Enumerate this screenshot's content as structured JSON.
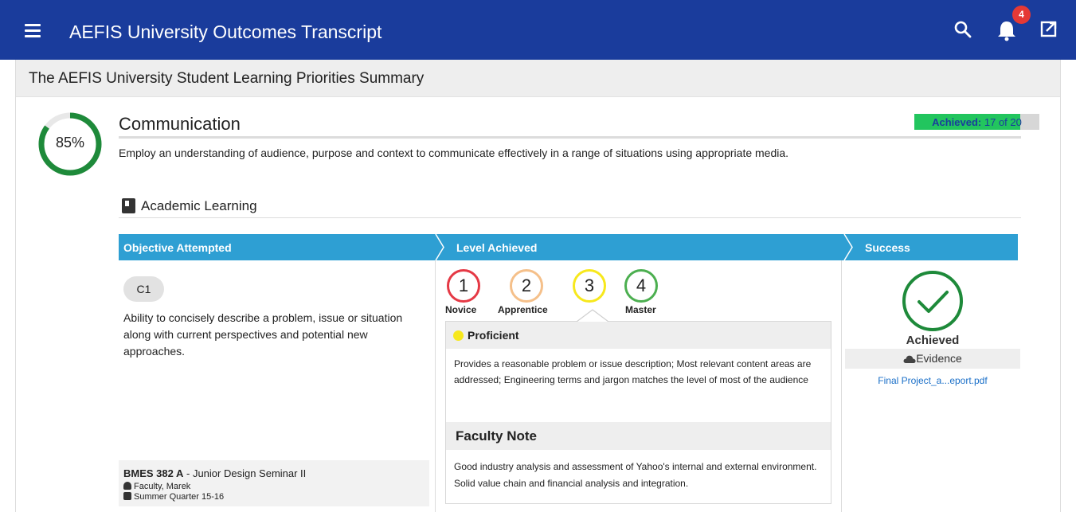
{
  "app_bar": {
    "title": "AEFIS University Outcomes Transcript",
    "notification_count": "4",
    "background_color": "#1a3c9c"
  },
  "card": {
    "title": "The AEFIS University Student Learning Priorities Summary"
  },
  "outcome": {
    "percent_label": "85%",
    "percent_value": 0.85,
    "title": "Communication",
    "achieved_label": "Achieved:",
    "achieved_count": "17 of 20",
    "achieved_fraction": 0.85,
    "description": "Employ an understanding of audience, purpose and context to communicate effectively in a range of situations using appropriate media."
  },
  "section": {
    "icon": "book-icon",
    "title": "Academic Learning"
  },
  "table": {
    "headers": [
      "Objective Attempted",
      "Level Achieved",
      "Success"
    ],
    "header_color": "#2e9fd3"
  },
  "objective": {
    "code": "C1",
    "description": "Ability to concisely describe a problem, issue or situation along with current perspectives and potential new approaches.",
    "course_code": "BMES 382 A",
    "course_name": " - Junior Design Seminar II",
    "faculty": "Faculty, Marek",
    "term": "Summer Quarter 15-16"
  },
  "levels": {
    "items": [
      {
        "number": "1",
        "label": "Novice",
        "color": "#e53945"
      },
      {
        "number": "2",
        "label": "Apprentice",
        "color": "#f5c08a"
      },
      {
        "number": "3",
        "label": "",
        "color": "#f7e81c"
      },
      {
        "number": "4",
        "label": "Master",
        "color": "#4caf50"
      }
    ],
    "selected_index": 2,
    "selected_name": "Proficient",
    "selected_description": "Provides a reasonable problem or issue description; Most relevant content areas are addressed; Engineering terms and jargon matches the level of most of the audience",
    "faculty_note_title": "Faculty Note",
    "faculty_note": "Good industry analysis and assessment of Yahoo's internal and external environment. Solid value chain and financial analysis and integration."
  },
  "success": {
    "status": "Achieved",
    "evidence_label": "Evidence",
    "evidence_file": "Final Project_a...eport.pdf",
    "status_color": "#1e8a3a"
  }
}
